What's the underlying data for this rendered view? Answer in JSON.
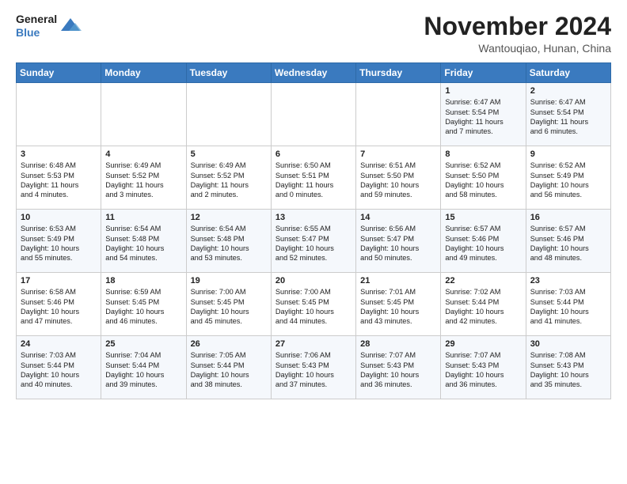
{
  "logo": {
    "line1": "General",
    "line2": "Blue"
  },
  "title": "November 2024",
  "location": "Wantouqiao, Hunan, China",
  "days_of_week": [
    "Sunday",
    "Monday",
    "Tuesday",
    "Wednesday",
    "Thursday",
    "Friday",
    "Saturday"
  ],
  "weeks": [
    [
      {
        "day": "",
        "info": ""
      },
      {
        "day": "",
        "info": ""
      },
      {
        "day": "",
        "info": ""
      },
      {
        "day": "",
        "info": ""
      },
      {
        "day": "",
        "info": ""
      },
      {
        "day": "1",
        "info": "Sunrise: 6:47 AM\nSunset: 5:54 PM\nDaylight: 11 hours\nand 7 minutes."
      },
      {
        "day": "2",
        "info": "Sunrise: 6:47 AM\nSunset: 5:54 PM\nDaylight: 11 hours\nand 6 minutes."
      }
    ],
    [
      {
        "day": "3",
        "info": "Sunrise: 6:48 AM\nSunset: 5:53 PM\nDaylight: 11 hours\nand 4 minutes."
      },
      {
        "day": "4",
        "info": "Sunrise: 6:49 AM\nSunset: 5:52 PM\nDaylight: 11 hours\nand 3 minutes."
      },
      {
        "day": "5",
        "info": "Sunrise: 6:49 AM\nSunset: 5:52 PM\nDaylight: 11 hours\nand 2 minutes."
      },
      {
        "day": "6",
        "info": "Sunrise: 6:50 AM\nSunset: 5:51 PM\nDaylight: 11 hours\nand 0 minutes."
      },
      {
        "day": "7",
        "info": "Sunrise: 6:51 AM\nSunset: 5:50 PM\nDaylight: 10 hours\nand 59 minutes."
      },
      {
        "day": "8",
        "info": "Sunrise: 6:52 AM\nSunset: 5:50 PM\nDaylight: 10 hours\nand 58 minutes."
      },
      {
        "day": "9",
        "info": "Sunrise: 6:52 AM\nSunset: 5:49 PM\nDaylight: 10 hours\nand 56 minutes."
      }
    ],
    [
      {
        "day": "10",
        "info": "Sunrise: 6:53 AM\nSunset: 5:49 PM\nDaylight: 10 hours\nand 55 minutes."
      },
      {
        "day": "11",
        "info": "Sunrise: 6:54 AM\nSunset: 5:48 PM\nDaylight: 10 hours\nand 54 minutes."
      },
      {
        "day": "12",
        "info": "Sunrise: 6:54 AM\nSunset: 5:48 PM\nDaylight: 10 hours\nand 53 minutes."
      },
      {
        "day": "13",
        "info": "Sunrise: 6:55 AM\nSunset: 5:47 PM\nDaylight: 10 hours\nand 52 minutes."
      },
      {
        "day": "14",
        "info": "Sunrise: 6:56 AM\nSunset: 5:47 PM\nDaylight: 10 hours\nand 50 minutes."
      },
      {
        "day": "15",
        "info": "Sunrise: 6:57 AM\nSunset: 5:46 PM\nDaylight: 10 hours\nand 49 minutes."
      },
      {
        "day": "16",
        "info": "Sunrise: 6:57 AM\nSunset: 5:46 PM\nDaylight: 10 hours\nand 48 minutes."
      }
    ],
    [
      {
        "day": "17",
        "info": "Sunrise: 6:58 AM\nSunset: 5:46 PM\nDaylight: 10 hours\nand 47 minutes."
      },
      {
        "day": "18",
        "info": "Sunrise: 6:59 AM\nSunset: 5:45 PM\nDaylight: 10 hours\nand 46 minutes."
      },
      {
        "day": "19",
        "info": "Sunrise: 7:00 AM\nSunset: 5:45 PM\nDaylight: 10 hours\nand 45 minutes."
      },
      {
        "day": "20",
        "info": "Sunrise: 7:00 AM\nSunset: 5:45 PM\nDaylight: 10 hours\nand 44 minutes."
      },
      {
        "day": "21",
        "info": "Sunrise: 7:01 AM\nSunset: 5:45 PM\nDaylight: 10 hours\nand 43 minutes."
      },
      {
        "day": "22",
        "info": "Sunrise: 7:02 AM\nSunset: 5:44 PM\nDaylight: 10 hours\nand 42 minutes."
      },
      {
        "day": "23",
        "info": "Sunrise: 7:03 AM\nSunset: 5:44 PM\nDaylight: 10 hours\nand 41 minutes."
      }
    ],
    [
      {
        "day": "24",
        "info": "Sunrise: 7:03 AM\nSunset: 5:44 PM\nDaylight: 10 hours\nand 40 minutes."
      },
      {
        "day": "25",
        "info": "Sunrise: 7:04 AM\nSunset: 5:44 PM\nDaylight: 10 hours\nand 39 minutes."
      },
      {
        "day": "26",
        "info": "Sunrise: 7:05 AM\nSunset: 5:44 PM\nDaylight: 10 hours\nand 38 minutes."
      },
      {
        "day": "27",
        "info": "Sunrise: 7:06 AM\nSunset: 5:43 PM\nDaylight: 10 hours\nand 37 minutes."
      },
      {
        "day": "28",
        "info": "Sunrise: 7:07 AM\nSunset: 5:43 PM\nDaylight: 10 hours\nand 36 minutes."
      },
      {
        "day": "29",
        "info": "Sunrise: 7:07 AM\nSunset: 5:43 PM\nDaylight: 10 hours\nand 36 minutes."
      },
      {
        "day": "30",
        "info": "Sunrise: 7:08 AM\nSunset: 5:43 PM\nDaylight: 10 hours\nand 35 minutes."
      }
    ]
  ]
}
